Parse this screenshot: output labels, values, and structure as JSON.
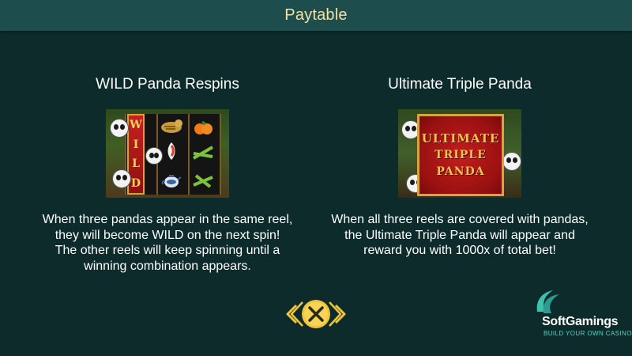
{
  "header": {
    "title": "Paytable"
  },
  "sections": [
    {
      "heading": "WILD Panda Respins",
      "lines": [
        "When three pandas appear in the same reel,",
        "they will become WILD on the next spin!",
        "The other reels will keep spinning until a",
        "winning combination appears."
      ],
      "image": {
        "wild_letters": [
          "W",
          "I",
          "L",
          "D"
        ]
      }
    },
    {
      "heading": "Ultimate Triple Panda",
      "lines": [
        "When all three reels are covered with pandas,",
        "the Ultimate Triple Panda will appear and",
        "reward you with 1000x of total bet!"
      ],
      "image": {
        "banner": [
          "ULTIMATE",
          "TRIPLE",
          "PANDA"
        ]
      }
    }
  ],
  "close_button": {
    "icon": "close-icon",
    "arrows": [
      "chevron-left-icon",
      "chevron-right-icon"
    ]
  },
  "brand": {
    "name": "SoftGamings",
    "tagline": "BUILD YOUR OWN CASINO"
  },
  "colors": {
    "background": "#0d2b2b",
    "header_bar": "#1e4d4d",
    "title_text": "#f1e1a6",
    "button_gold": "#f0c53c",
    "brand_accent": "#4fd6c4"
  }
}
